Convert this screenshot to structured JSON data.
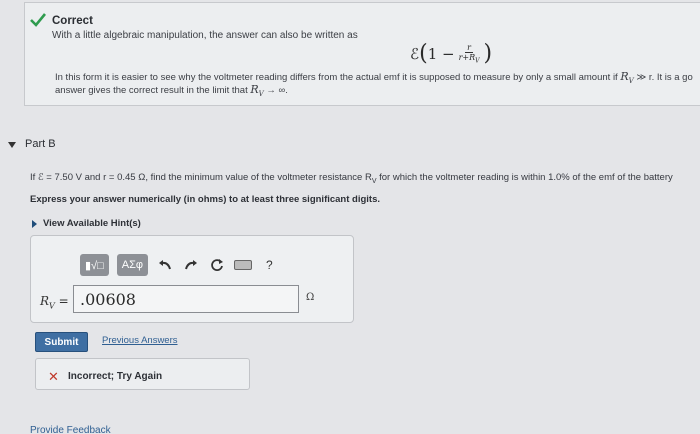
{
  "correct": {
    "title": "Correct",
    "line1": "With a little algebraic manipulation, the answer can also be written as",
    "formula_prefix": "ℰ",
    "formula_num": "r",
    "formula_den": "r+R",
    "formula_den_sub": "V",
    "line2_a": "In this form it is easier to see why the voltmeter reading differs from the actual emf it is supposed to measure by only a small amount if ",
    "line2_math": "R",
    "line2_math_sub": "V",
    "line2_b": " ≫ r. It is a go",
    "line3_a": "answer gives the correct result in the limit that ",
    "line3_math": "R",
    "line3_math_sub": "V",
    "line3_b": " → ∞."
  },
  "part_b": {
    "title": "Part B",
    "question": "If ℰ = 7.50 V and r = 0.45 Ω, find the minimum value of the voltmeter resistance R",
    "question_sub": "V",
    "question_tail": " for which the voltmeter reading is within 1.0% of the emf of the battery",
    "instruction": "Express your answer numerically (in ohms) to at least three significant digits.",
    "hints_label": "View Available Hint(s)"
  },
  "toolbar": {
    "templates_label": "▮√□",
    "symbols_label": "ΑΣφ",
    "undo_icon": "undo-icon",
    "redo_icon": "redo-icon",
    "reset_icon": "reset-icon",
    "keyboard_icon": "keyboard-icon",
    "help_label": "?"
  },
  "answer": {
    "label": "R",
    "label_sub": "V",
    "label_eq": " =",
    "value": ".00608",
    "unit": "Ω"
  },
  "actions": {
    "submit_label": "Submit",
    "previous_answers_label": "Previous Answers"
  },
  "feedback": {
    "status": "Incorrect; Try Again",
    "provide_feedback": "Provide Feedback"
  },
  "colors": {
    "check": "#2e9b4e",
    "incorrect_x": "#c0392b",
    "submit_bg": "#3f6fa3",
    "link": "#2f5f92"
  }
}
